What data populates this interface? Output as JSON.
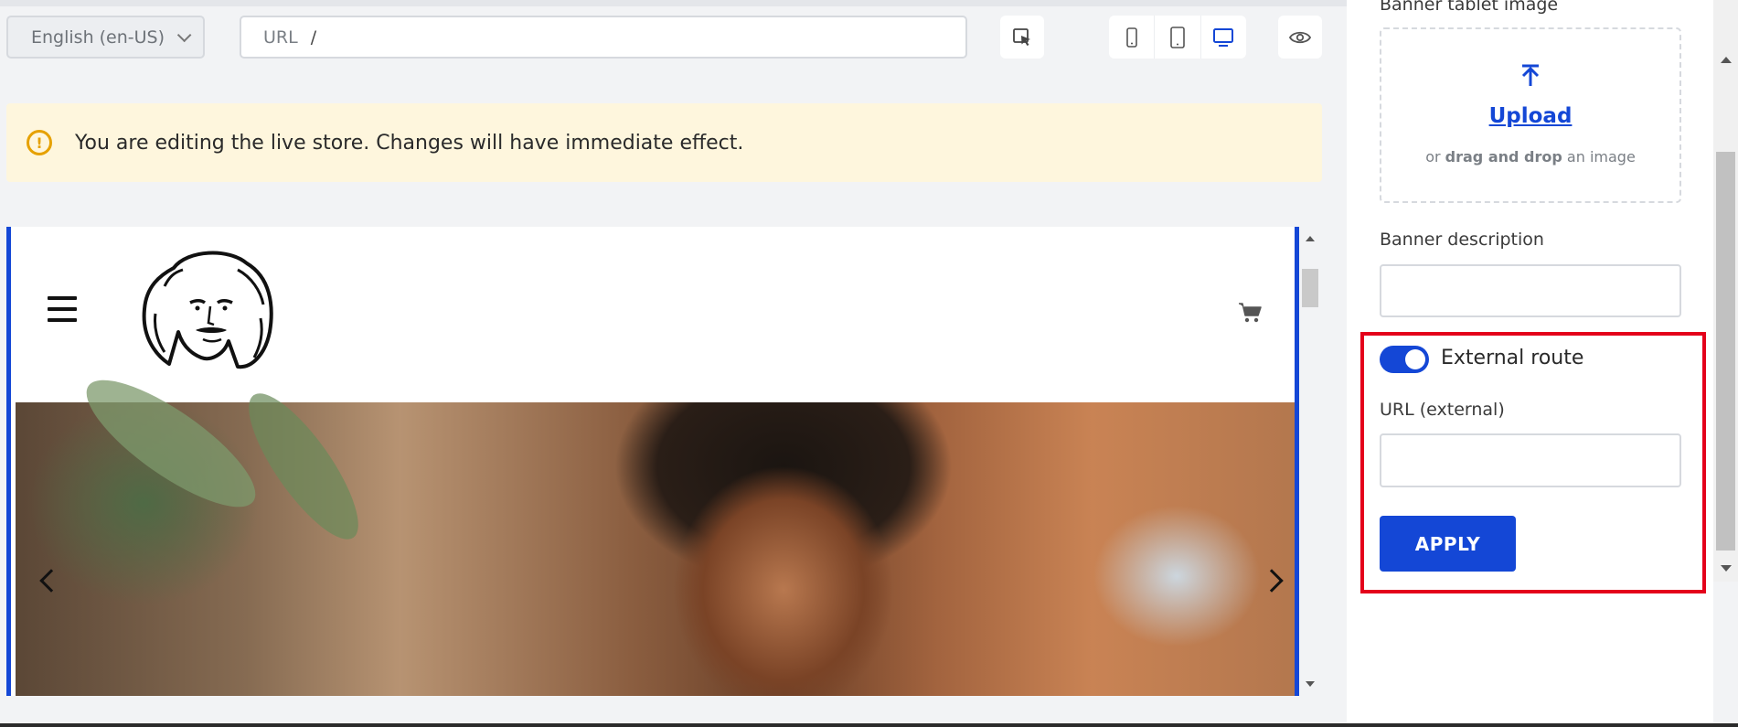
{
  "toolbar": {
    "language": "English (en-US)",
    "url_label": "URL",
    "url_value": "/"
  },
  "notice": {
    "text": "You are editing the live store. Changes will have immediate effect."
  },
  "panel": {
    "banner_tablet_image_label": "Banner tablet image",
    "upload_link": "Upload",
    "upload_hint_prefix": "or",
    "upload_hint_bold": "drag and drop",
    "upload_hint_suffix": "an image",
    "banner_description_label": "Banner description",
    "banner_description_value": "",
    "external_route_label": "External route",
    "external_route_enabled": true,
    "url_external_label": "URL (external)",
    "url_external_value": "",
    "apply_label": "APPLY"
  },
  "colors": {
    "accent": "#1447d6",
    "notice_bg": "#fef6dd",
    "warning": "#e6a100",
    "highlight": "#e4001b"
  },
  "icons": [
    "chevron-down-icon",
    "select-element-icon",
    "mobile-icon",
    "tablet-icon",
    "desktop-icon",
    "eye-icon",
    "warning-icon",
    "menu-icon",
    "cart-icon",
    "upload-arrow-icon",
    "chevron-left-icon",
    "chevron-right-icon"
  ]
}
